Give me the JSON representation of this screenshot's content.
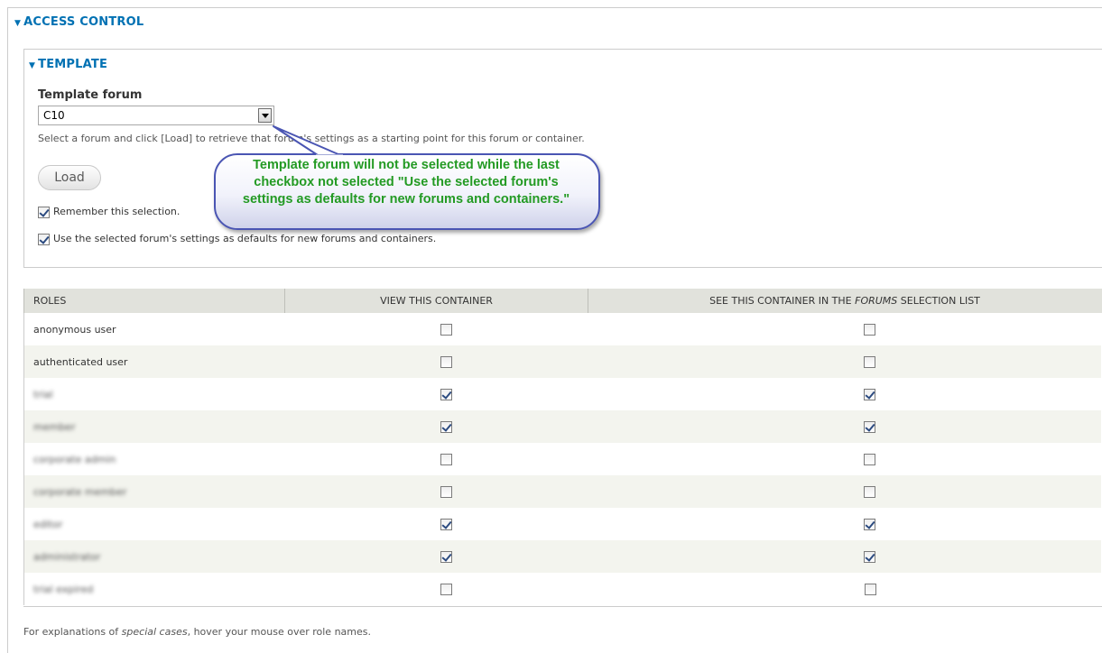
{
  "access_control": {
    "legend": "ACCESS CONTROL"
  },
  "template": {
    "legend": "TEMPLATE",
    "label": "Template forum",
    "select_value": "C10",
    "description": "Select a forum and click [Load] to retrieve that forum's settings as a starting point for this forum or container.",
    "load_button": "Load",
    "remember_label": "Remember this selection.",
    "remember_checked": true,
    "defaults_label": "Use the selected forum's settings as defaults for new forums and containers.",
    "defaults_checked": true
  },
  "callout": {
    "text": "Template forum will not be selected while the last checkbox not selected \"Use the selected forum's settings as defaults for new forums and containers.\""
  },
  "table": {
    "headers": {
      "roles": "ROLES",
      "view": "VIEW THIS CONTAINER",
      "see_prefix": "SEE THIS CONTAINER IN THE",
      "see_em": "FORUMS",
      "see_suffix": "SELECTION LIST"
    },
    "rows": [
      {
        "role": "anonymous user",
        "view": false,
        "see": false,
        "blurred": false
      },
      {
        "role": "authenticated user",
        "view": false,
        "see": false,
        "blurred": false
      },
      {
        "role": "trial",
        "view": true,
        "see": true,
        "blurred": true
      },
      {
        "role": "member",
        "view": true,
        "see": true,
        "blurred": true
      },
      {
        "role": "corporate admin",
        "view": false,
        "see": false,
        "blurred": true
      },
      {
        "role": "corporate member",
        "view": false,
        "see": false,
        "blurred": true
      },
      {
        "role": "editor",
        "view": true,
        "see": true,
        "blurred": true
      },
      {
        "role": "administrator",
        "view": true,
        "see": true,
        "blurred": true
      },
      {
        "role": "trial expired",
        "view": false,
        "see": false,
        "blurred": true
      }
    ]
  },
  "footnote": {
    "prefix": "For explanations of",
    "em": "special cases",
    "suffix": ", hover your mouse over role names."
  },
  "colors": {
    "legend": "#0071b3",
    "callout_text": "#239a23",
    "callout_border": "#4a55b3",
    "header_bg": "#e1e2dc",
    "row_alt_bg": "#f3f4ee"
  }
}
